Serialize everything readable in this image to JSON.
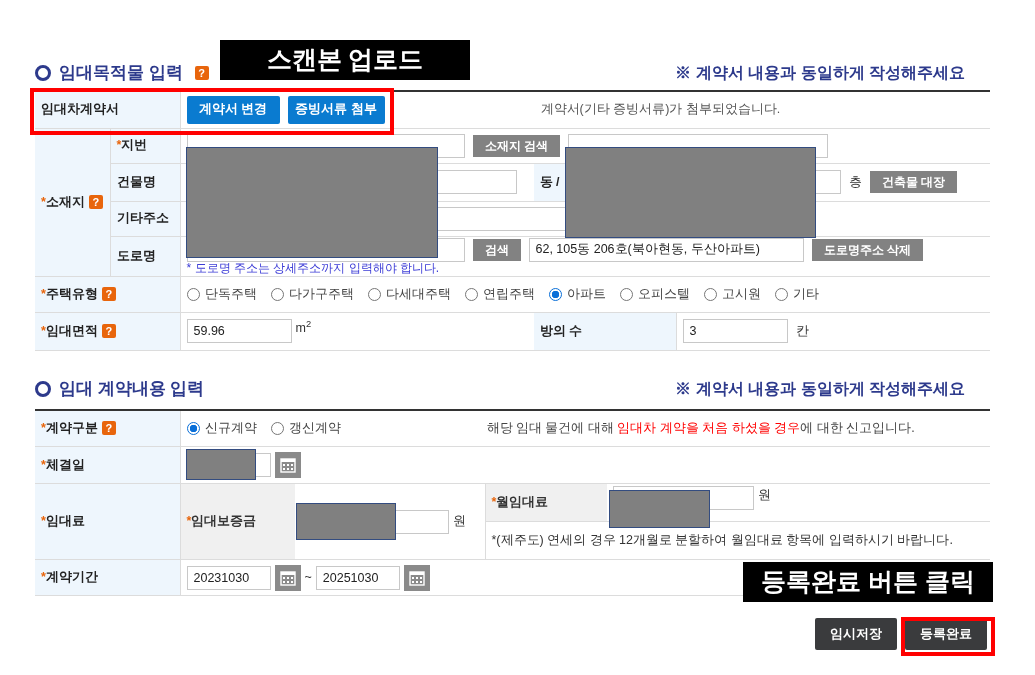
{
  "annotations": [
    {
      "text": "스캔본 업로드"
    },
    {
      "text": "등록완료 버튼 클릭"
    }
  ],
  "section1": {
    "title": "임대목적물 입력",
    "help": "?",
    "note": "※ 계약서 내용과 동일하게 작성해주세요"
  },
  "contract_doc": {
    "label": "임대차계약서",
    "highlighted": true,
    "buttons": [
      "계약서 변경",
      "증빙서류 첨부"
    ],
    "message": "계약서(기타 증빙서류)가 첨부되었습니다."
  },
  "location": {
    "required_mark": "*",
    "label": "소재지",
    "help": "?",
    "lot": {
      "required_mark": "*",
      "label": "지번",
      "button": "소재지 검색"
    },
    "building": {
      "label": "건물명",
      "dong_label": "동 /",
      "floor_unit": "층",
      "button": "건축물 대장"
    },
    "other": {
      "label": "기타주소"
    },
    "road": {
      "label": "도로명",
      "button": "검색",
      "address": "62, 105동 206호(북아현동, 두산아파트)",
      "delete_button": "도로명주소 삭제",
      "hint": "* 도로명 주소는 상세주소까지 입력해야 합니다."
    }
  },
  "housing_type": {
    "required_mark": "*",
    "label": "주택유형",
    "help": "?",
    "options": [
      {
        "label": "단독주택",
        "selected": false
      },
      {
        "label": "다가구주택",
        "selected": false
      },
      {
        "label": "다세대주택",
        "selected": false
      },
      {
        "label": "연립주택",
        "selected": false
      },
      {
        "label": "아파트",
        "selected": true
      },
      {
        "label": "오피스텔",
        "selected": false
      },
      {
        "label": "고시원",
        "selected": false
      },
      {
        "label": "기타",
        "selected": false
      }
    ]
  },
  "area": {
    "required_mark": "*",
    "label": "임대면적",
    "help": "?",
    "value": "59.96",
    "unit": "m$^{2}$",
    "rooms_label": "방의 수",
    "rooms": "3",
    "rooms_unit": "칸"
  },
  "section2": {
    "title": "임대 계약내용 입력",
    "note": "※ 계약서 내용과 동일하게 작성해주세요"
  },
  "contract_kind": {
    "required_mark": "*",
    "label": "계약구분",
    "help": "?",
    "options": [
      {
        "label": "신규계약",
        "selected": true
      },
      {
        "label": "갱신계약",
        "selected": false
      }
    ],
    "message_parts": [
      {
        "text": "해당 임대 물건에 대해 ",
        "highlight": false
      },
      {
        "text": "임대차 계약을 처음 하셨을 경우",
        "highlight": true
      },
      {
        "text": "에 대한 신고입니다.",
        "highlight": false
      }
    ]
  },
  "signed_date": {
    "required_mark": "*",
    "label": "체결일"
  },
  "rent": {
    "required_mark": "*",
    "label": "임대료",
    "deposit": {
      "required_mark": "*",
      "label": "임대보증금",
      "unit": "원"
    },
    "monthly": {
      "required_mark": "*",
      "label": "월임대료",
      "unit": "원"
    },
    "note": "*(제주도) 연세의 경우 12개월로 분할하여 월임대료 항목에 입력하시기 바랍니다."
  },
  "period": {
    "required_mark": "*",
    "label": "계약기간",
    "start": "20231030",
    "separator": "~",
    "end": "20251030"
  },
  "buttons": [
    {
      "label": "임시저장",
      "highlighted": false
    },
    {
      "label": "등록완료",
      "highlighted": true
    }
  ]
}
